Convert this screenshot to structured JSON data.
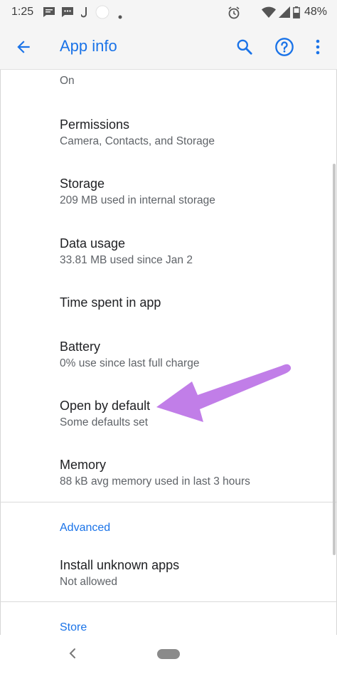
{
  "status": {
    "time": "1:25",
    "battery": "48%"
  },
  "appbar": {
    "title": "App info"
  },
  "top_value": "On",
  "items": [
    {
      "title": "Permissions",
      "subtitle": "Camera, Contacts, and Storage"
    },
    {
      "title": "Storage",
      "subtitle": "209 MB used in internal storage"
    },
    {
      "title": "Data usage",
      "subtitle": "33.81 MB used since Jan 2"
    },
    {
      "title": "Time spent in app"
    },
    {
      "title": "Battery",
      "subtitle": "0% use since last full charge"
    },
    {
      "title": "Open by default",
      "subtitle": "Some defaults set"
    },
    {
      "title": "Memory",
      "subtitle": "88 kB avg memory used in last 3 hours"
    }
  ],
  "advanced": {
    "header": "Advanced",
    "items": [
      {
        "title": "Install unknown apps",
        "subtitle": "Not allowed"
      }
    ]
  },
  "store": {
    "header": "Store"
  },
  "colors": {
    "accent": "#1a73e8",
    "annotation_arrow": "#c17ee8"
  }
}
